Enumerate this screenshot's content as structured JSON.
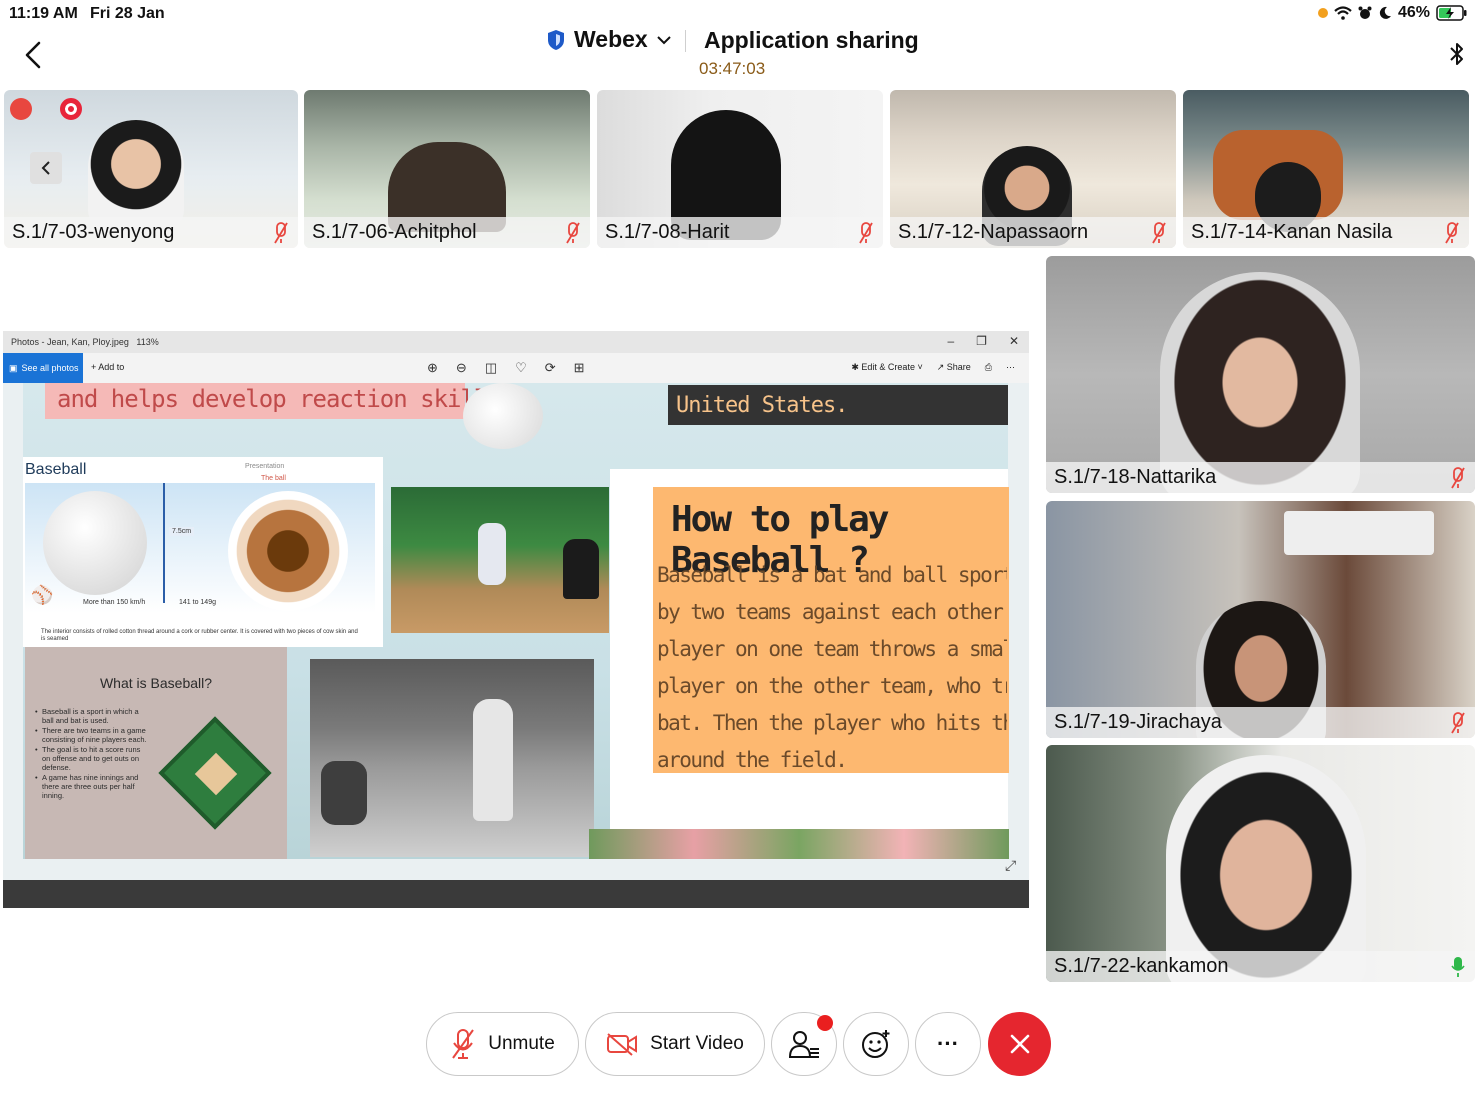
{
  "status_bar": {
    "time": "11:19 AM",
    "date": "Fri 28 Jan",
    "battery": "46%"
  },
  "header": {
    "app_name": "Webex",
    "title": "Application sharing",
    "timer": "03:47:03"
  },
  "top_participants": [
    {
      "name": "S.1/7-03-wenyong"
    },
    {
      "name": "S.1/7-06-Achitphol"
    },
    {
      "name": "S.1/7-08-Harit"
    },
    {
      "name": "S.1/7-12-Napassaorn"
    },
    {
      "name": "S.1/7-14-Kanan Nasila"
    }
  ],
  "side_participants": [
    {
      "name": "S.1/7-18-Nattarika",
      "mic": "muted"
    },
    {
      "name": "S.1/7-19-Jirachaya",
      "mic": "muted"
    },
    {
      "name": "S.1/7-22-kankamon",
      "mic": "active"
    }
  ],
  "shared_window": {
    "title": "Photos - Jean, Kan, Ploy.jpeg",
    "zoom": "113%",
    "see_all": "See all photos",
    "add_to": "Add to",
    "edit_create": "Edit & Create",
    "share": "Share",
    "content": {
      "pink_text": "and helps develop reaction skills.",
      "us_text": "United States.",
      "baseball_title": "Baseball",
      "presentation": "Presentation",
      "the_ball": "The ball",
      "size_label": "7.5cm",
      "speed_label": "More than 150 km/h",
      "weight_label": "141 to 149g",
      "interior_caption": "The interior consists of rolled cotton thread around a cork or rubber center. It is covered with two pieces of cow skin and is seamed",
      "howto_title": "How to play Baseball ?",
      "howto_lines": [
        "Baseball is a bat and ball sport played o",
        "by two teams against each other. In bas",
        "player on one team throws a small rounc",
        "player on the other team, who tries to h",
        "bat. Then the player who hits the ball ha",
        "around the field."
      ],
      "what_title": "What is Baseball?",
      "what_bullets": [
        "Baseball is a sport in which a ball and bat is used.",
        "There are two teams in a game consisting of nine players each.",
        "The goal is to hit a score runs on offense and to get outs on defense.",
        "A game has nine innings and there are three outs per half inning."
      ]
    }
  },
  "controls": {
    "unmute_label": "Unmute",
    "start_video_label": "Start Video",
    "more_label": "···"
  },
  "colors": {
    "end_call": "#e5262f",
    "mic_muted": "#e8473f",
    "mic_active": "#2fb84a",
    "timer": "#8a5b18"
  }
}
